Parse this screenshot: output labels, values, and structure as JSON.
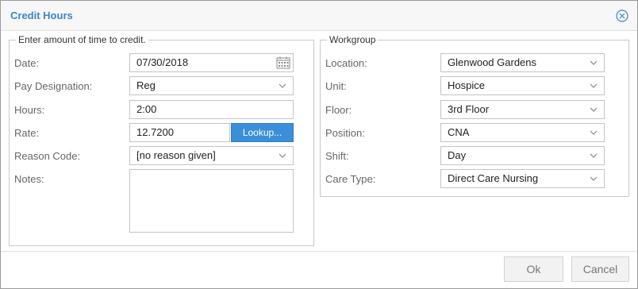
{
  "dialog": {
    "title": "Credit Hours"
  },
  "credit": {
    "legend": "Enter amount of time to credit.",
    "date_label": "Date:",
    "date_value": "07/30/2018",
    "pay_label": "Pay Designation:",
    "pay_value": "Reg",
    "hours_label": "Hours:",
    "hours_value": "2:00",
    "rate_label": "Rate:",
    "rate_value": "12.7200",
    "lookup_label": "Lookup...",
    "reason_label": "Reason Code:",
    "reason_value": "[no reason given]",
    "notes_label": "Notes:",
    "notes_value": ""
  },
  "workgroup": {
    "legend": "Workgroup",
    "location_label": "Location:",
    "location_value": "Glenwood Gardens",
    "unit_label": "Unit:",
    "unit_value": "Hospice",
    "floor_label": "Floor:",
    "floor_value": "3rd Floor",
    "position_label": "Position:",
    "position_value": "CNA",
    "shift_label": "Shift:",
    "shift_value": "Day",
    "caretype_label": "Care Type:",
    "caretype_value": "Direct Care Nursing"
  },
  "footer": {
    "ok_label": "Ok",
    "cancel_label": "Cancel"
  },
  "colors": {
    "accent": "#3b8fd9",
    "title": "#3a86c8"
  }
}
